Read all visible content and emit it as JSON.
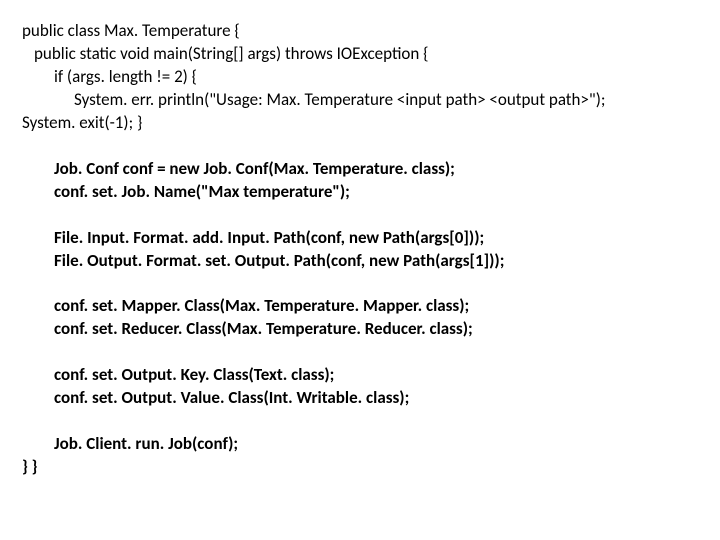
{
  "lines": {
    "l1": "public class Max. Temperature {",
    "l2": "public static void main(String[] args) throws IOException {",
    "l3": "if (args. length != 2) {",
    "l4": "System. err. println(\"Usage: Max. Temperature <input path> <output path>\");",
    "l5": "System. exit(-1); }",
    "l6": "Job. Conf conf = new Job. Conf(Max. Temperature. class);",
    "l7": "conf. set. Job. Name(\"Max temperature\");",
    "l8": "File. Input. Format. add. Input. Path(conf, new Path(args[0]));",
    "l9": "File. Output. Format. set. Output. Path(conf, new Path(args[1]));",
    "l10": "conf. set. Mapper. Class(Max. Temperature. Mapper. class);",
    "l11": "conf. set. Reducer. Class(Max. Temperature. Reducer. class);",
    "l12": "conf. set. Output. Key. Class(Text. class);",
    "l13": "conf. set. Output. Value. Class(Int. Writable. class);",
    "l14": "Job. Client. run. Job(conf);",
    "l15": "} }"
  }
}
